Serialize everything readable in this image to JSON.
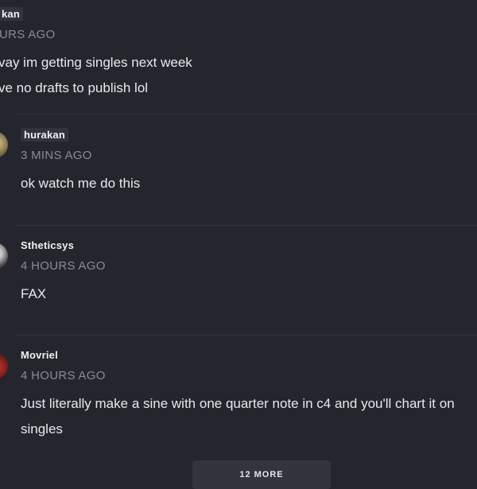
{
  "comments": [
    {
      "username": "kan",
      "timestamp": "URS AGO",
      "lines": [
        "vay im getting singles next week",
        "ve no drafts to publish lol"
      ]
    },
    {
      "username": "hurakan",
      "timestamp": "3 MINS AGO",
      "lines": [
        "ok watch me do this"
      ]
    },
    {
      "username": "Stheticsys",
      "timestamp": "4 HOURS AGO",
      "lines": [
        "FAX"
      ]
    },
    {
      "username": "Movriel",
      "timestamp": "4 HOURS AGO",
      "lines": [
        "Just literally make a sine with one quarter note in c4 and you'll chart it on",
        "singles"
      ]
    }
  ],
  "more_button": {
    "label": "12 MORE"
  },
  "colors": {
    "background": "#25252e",
    "text": "#e8e8ec",
    "muted": "#8b8b97",
    "button": "#34343e"
  }
}
